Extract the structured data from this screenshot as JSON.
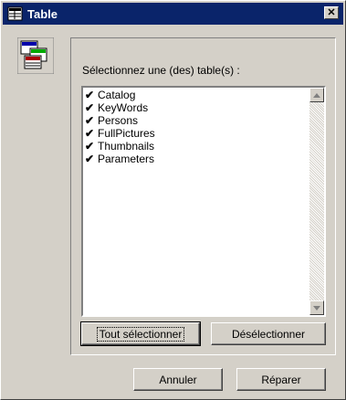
{
  "window": {
    "title": "Table"
  },
  "panel": {
    "prompt": "Sélectionnez une (des) table(s) :"
  },
  "tables": [
    {
      "label": "Catalog",
      "checked": true
    },
    {
      "label": "KeyWords",
      "checked": true
    },
    {
      "label": "Persons",
      "checked": true
    },
    {
      "label": "FullPictures",
      "checked": true
    },
    {
      "label": "Thumbnails",
      "checked": true
    },
    {
      "label": "Parameters",
      "checked": true
    }
  ],
  "check_mark": "✔",
  "buttons": {
    "select_all": "Tout sélectionner",
    "deselect": "Désélectionner",
    "cancel": "Annuler",
    "repair": "Réparer"
  },
  "icons": {
    "title": "table-window-icon",
    "main": "database-tables-icon",
    "close": "close-icon"
  },
  "colors": {
    "titlebar": "#0a246a",
    "face": "#d4d0c8"
  }
}
